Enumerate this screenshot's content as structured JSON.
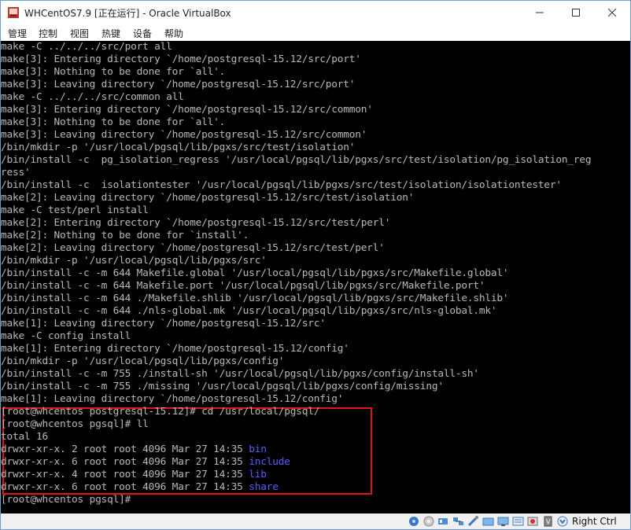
{
  "window": {
    "title": "WHCentOS7.9 [正在运行] - Oracle VirtualBox"
  },
  "menu": [
    "管理",
    "控制",
    "视图",
    "热键",
    "设备",
    "帮助"
  ],
  "terminal": {
    "lines": [
      {
        "text": "make -C ../../../src/port all"
      },
      {
        "text": "make[3]: Entering directory `/home/postgresql-15.12/src/port'"
      },
      {
        "text": "make[3]: Nothing to be done for `all'."
      },
      {
        "text": "make[3]: Leaving directory `/home/postgresql-15.12/src/port'"
      },
      {
        "text": "make -C ../../../src/common all"
      },
      {
        "text": "make[3]: Entering directory `/home/postgresql-15.12/src/common'"
      },
      {
        "text": "make[3]: Nothing to be done for `all'."
      },
      {
        "text": "make[3]: Leaving directory `/home/postgresql-15.12/src/common'"
      },
      {
        "text": "/bin/mkdir -p '/usr/local/pgsql/lib/pgxs/src/test/isolation'"
      },
      {
        "text": "/bin/install -c  pg_isolation_regress '/usr/local/pgsql/lib/pgxs/src/test/isolation/pg_isolation_reg"
      },
      {
        "text": "ress'"
      },
      {
        "text": "/bin/install -c  isolationtester '/usr/local/pgsql/lib/pgxs/src/test/isolation/isolationtester'"
      },
      {
        "text": "make[2]: Leaving directory `/home/postgresql-15.12/src/test/isolation'"
      },
      {
        "text": "make -C test/perl install"
      },
      {
        "text": "make[2]: Entering directory `/home/postgresql-15.12/src/test/perl'"
      },
      {
        "text": "make[2]: Nothing to be done for `install'."
      },
      {
        "text": "make[2]: Leaving directory `/home/postgresql-15.12/src/test/perl'"
      },
      {
        "text": "/bin/mkdir -p '/usr/local/pgsql/lib/pgxs/src'"
      },
      {
        "text": "/bin/install -c -m 644 Makefile.global '/usr/local/pgsql/lib/pgxs/src/Makefile.global'"
      },
      {
        "text": "/bin/install -c -m 644 Makefile.port '/usr/local/pgsql/lib/pgxs/src/Makefile.port'"
      },
      {
        "text": "/bin/install -c -m 644 ./Makefile.shlib '/usr/local/pgsql/lib/pgxs/src/Makefile.shlib'"
      },
      {
        "text": "/bin/install -c -m 644 ./nls-global.mk '/usr/local/pgsql/lib/pgxs/src/nls-global.mk'"
      },
      {
        "text": "make[1]: Leaving directory `/home/postgresql-15.12/src'"
      },
      {
        "text": "make -C config install"
      },
      {
        "text": "make[1]: Entering directory `/home/postgresql-15.12/config'"
      },
      {
        "text": "/bin/mkdir -p '/usr/local/pgsql/lib/pgxs/config'"
      },
      {
        "text": "/bin/install -c -m 755 ./install-sh '/usr/local/pgsql/lib/pgxs/config/install-sh'"
      },
      {
        "text": "/bin/install -c -m 755 ./missing '/usr/local/pgsql/lib/pgxs/config/missing'"
      },
      {
        "text": "make[1]: Leaving directory `/home/postgresql-15.12/config'"
      },
      {
        "text": "[root@whcentos postgresql-15.12]# cd /usr/local/pgsql/"
      },
      {
        "text": "[root@whcentos pgsql]# ll"
      },
      {
        "text": "total 16"
      },
      {
        "text": "drwxr-xr-x. 2 root root 4096 Mar 27 14:35 ",
        "dir": "bin"
      },
      {
        "text": "drwxr-xr-x. 6 root root 4096 Mar 27 14:35 ",
        "dir": "include"
      },
      {
        "text": "drwxr-xr-x. 4 root root 4096 Mar 27 14:35 ",
        "dir": "lib"
      },
      {
        "text": "drwxr-xr-x. 6 root root 4096 Mar 27 14:35 ",
        "dir": "share"
      },
      {
        "text": "[root@whcentos pgsql]#"
      }
    ]
  },
  "statusbar": {
    "host_key": "Right Ctrl"
  },
  "colors": {
    "terminal_bg": "#000000",
    "terminal_fg": "#b8b8b8",
    "directory": "#5a5aff",
    "highlight": "#e01515"
  }
}
